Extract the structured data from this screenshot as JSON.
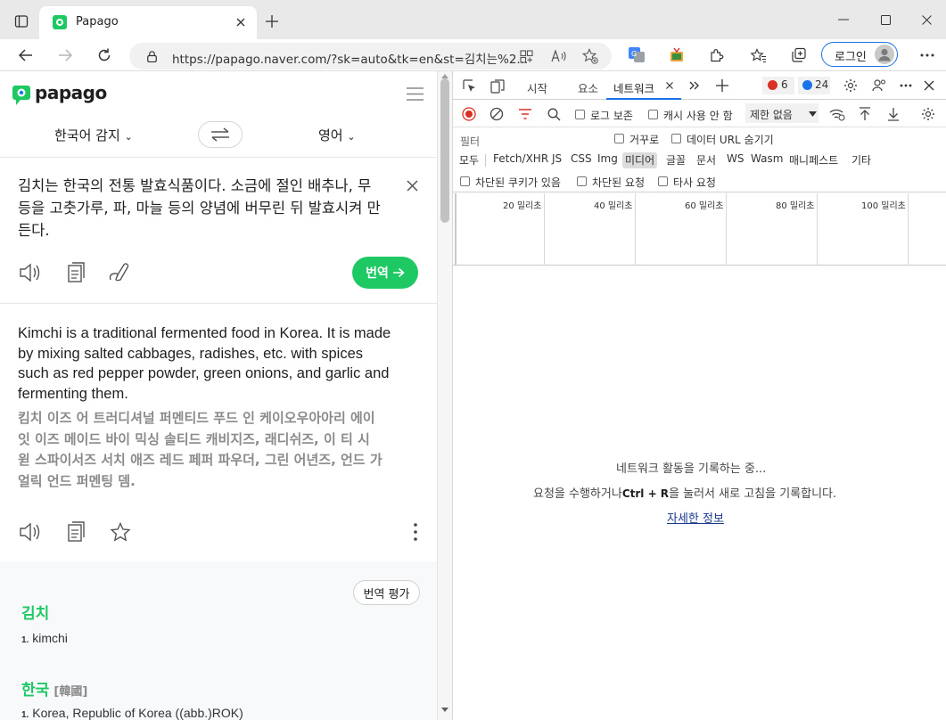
{
  "browser": {
    "tab_title": "Papago",
    "url": "https://papago.naver.com/?sk=auto&tk=en&st=김치는%2...",
    "login_label": "로그인"
  },
  "papago": {
    "logo": "papago",
    "source_lang": "한국어 감지",
    "target_lang": "영어",
    "source_text": "김치는 한국의 전통 발효식품이다. 소금에 절인 배추나, 무 등을 고춧가루, 파, 마늘 등의 양념에 버무린 뒤 발효시켜 만든다.",
    "translate_label": "번역",
    "translation": "Kimchi is a traditional fermented food in Korea. It is made by mixing salted cabbages, radishes, etc. with spices such as red pepper powder, green onions, and garlic and fermenting them.",
    "pronunciation": "킴치 이즈 어 트러디셔널 퍼멘티드 푸드 인 케이오우아아리 에이 잇 이즈 메이드 바이 믹싱 솔티드 캐비지즈, 래디쉬즈, 이 티 시 윋 스파이서즈 서치 애즈 레드 페퍼 파우더, 그린 어년즈, 언드 가얼릭 언드 퍼멘팅 뎀.",
    "rate_label": "번역 평가",
    "dictionary": [
      {
        "word": "김치",
        "hanja": "",
        "def_num": "1.",
        "def": "kimchi"
      },
      {
        "word": "한국",
        "hanja": "[韓國]",
        "def_num": "1.",
        "def": "Korea, Republic of Korea ((abb.)ROK)"
      }
    ]
  },
  "devtools": {
    "tabs": [
      "시작",
      "요소",
      "네트워크"
    ],
    "error_count": "6",
    "issue_count": "24",
    "preserve_log": "로그 보존",
    "disable_cache": "캐시 사용 안 함",
    "throttle": "제한 없음",
    "filter_placeholder": "필터",
    "invert": "거꾸로",
    "hide_data_urls": "데이터 URL 숨기기",
    "type_filters": [
      "모두",
      "Fetch/XHR",
      "JS",
      "CSS",
      "Img",
      "미디어",
      "글꼴",
      "문서",
      "WS",
      "Wasm",
      "매니페스트",
      "기타"
    ],
    "selected_type": "미디어",
    "blocked_cookies": "차단된 쿠키가 있음",
    "blocked_requests": "차단된 요청",
    "third_party": "타사 요청",
    "timeline_labels": [
      "20 밀리초",
      "40 밀리초",
      "60 밀리초",
      "80 밀리초",
      "100 밀리초"
    ],
    "empty_line1": "네트워크 활동을 기록하는 중...",
    "empty_line2_a": "요청을 수행하거나",
    "empty_line2_key": "Ctrl + R",
    "empty_line2_b": "을 눌러서 새로 고침을 기록합니다.",
    "learn_more": "자세한 정보"
  },
  "colors": {
    "papago_green": "#1ec964",
    "accent_blue": "#1a73e8",
    "record_red": "#d93025"
  }
}
